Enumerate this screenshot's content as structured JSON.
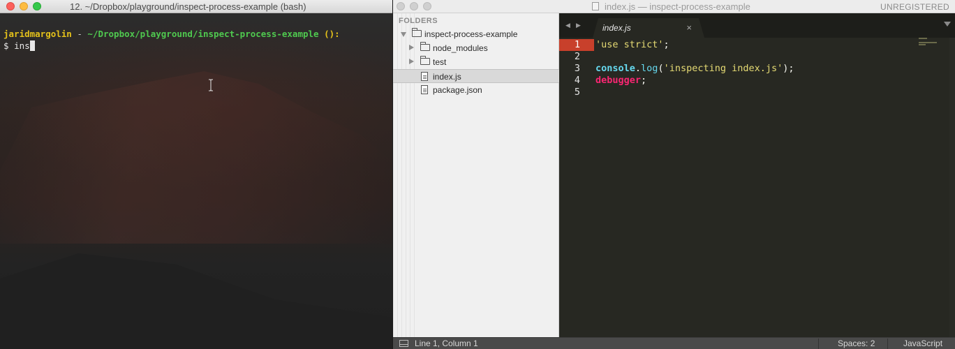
{
  "terminal": {
    "title": "12. ~/Dropbox/playground/inspect-process-example (bash)",
    "prompt_user": "jaridmargolin",
    "prompt_sep": " - ",
    "prompt_path": "~/Dropbox/playground/inspect-process-example",
    "prompt_git": " ():",
    "command_prefix": "$ ",
    "command": "ins"
  },
  "editor": {
    "window_title": "index.js — inspect-process-example",
    "unregistered": "UNREGISTERED",
    "sidebar": {
      "header": "FOLDERS",
      "root_folder": "inspect-process-example",
      "items": [
        {
          "label": "node_modules",
          "type": "folder"
        },
        {
          "label": "test",
          "type": "folder"
        },
        {
          "label": "index.js",
          "type": "file",
          "selected": true
        },
        {
          "label": "package.json",
          "type": "file"
        }
      ]
    },
    "tab": {
      "label": "index.js",
      "close": "×"
    },
    "line_numbers": [
      "1",
      "2",
      "3",
      "4",
      "5"
    ],
    "code": {
      "line1_str": "'use strict'",
      "line1_semi": ";",
      "line3_obj": "console",
      "line3_dot": ".",
      "line3_fn": "log",
      "line3_open": "(",
      "line3_str": "'inspecting index.js'",
      "line3_close": ");",
      "line4_kw": "debugger",
      "line4_semi": ";"
    },
    "status": {
      "position": "Line 1, Column 1",
      "spaces": "Spaces: 2",
      "syntax": "JavaScript"
    }
  },
  "colors": {
    "terminal_user": "#e5c21a",
    "terminal_path": "#4fc94f",
    "active_line_number": "#c8402b",
    "string": "#e6db74",
    "keyword": "#f92672",
    "builtin": "#66d9ef"
  }
}
